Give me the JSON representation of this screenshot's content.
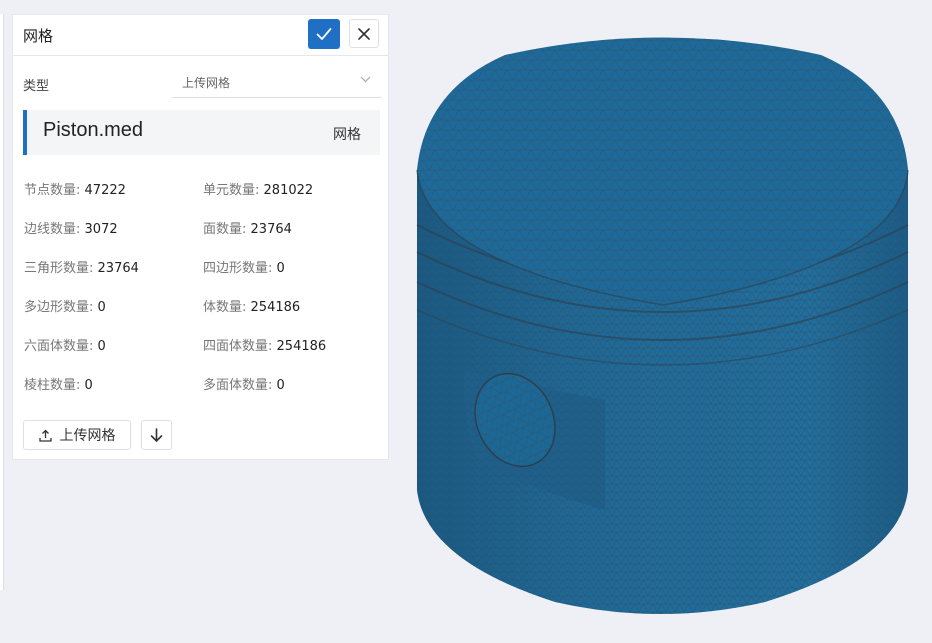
{
  "panel": {
    "title": "网格",
    "confirm_icon": "check-icon",
    "close_icon": "close-icon"
  },
  "type_field": {
    "label": "类型",
    "value": "上传网格"
  },
  "file": {
    "name": "Piston.med",
    "type": "网格"
  },
  "stats": [
    {
      "label": "节点数量:",
      "value": "47222"
    },
    {
      "label": "单元数量:",
      "value": "281022"
    },
    {
      "label": "边线数量:",
      "value": "3072"
    },
    {
      "label": "面数量:",
      "value": "23764"
    },
    {
      "label": "三角形数量:",
      "value": "23764"
    },
    {
      "label": "四边形数量:",
      "value": "0"
    },
    {
      "label": "多边形数量:",
      "value": "0"
    },
    {
      "label": "体数量:",
      "value": "254186"
    },
    {
      "label": "六面体数量:",
      "value": "0"
    },
    {
      "label": "四面体数量:",
      "value": "254186"
    },
    {
      "label": "棱柱数量:",
      "value": "0"
    },
    {
      "label": "多面体数量:",
      "value": "0"
    }
  ],
  "actions": {
    "upload_label": "上传网格",
    "download_icon": "arrow-down-icon"
  },
  "colors": {
    "accent": "#1f6fc5",
    "mesh_fill": "#1d6a9a",
    "mesh_line": "#3d4a55"
  }
}
